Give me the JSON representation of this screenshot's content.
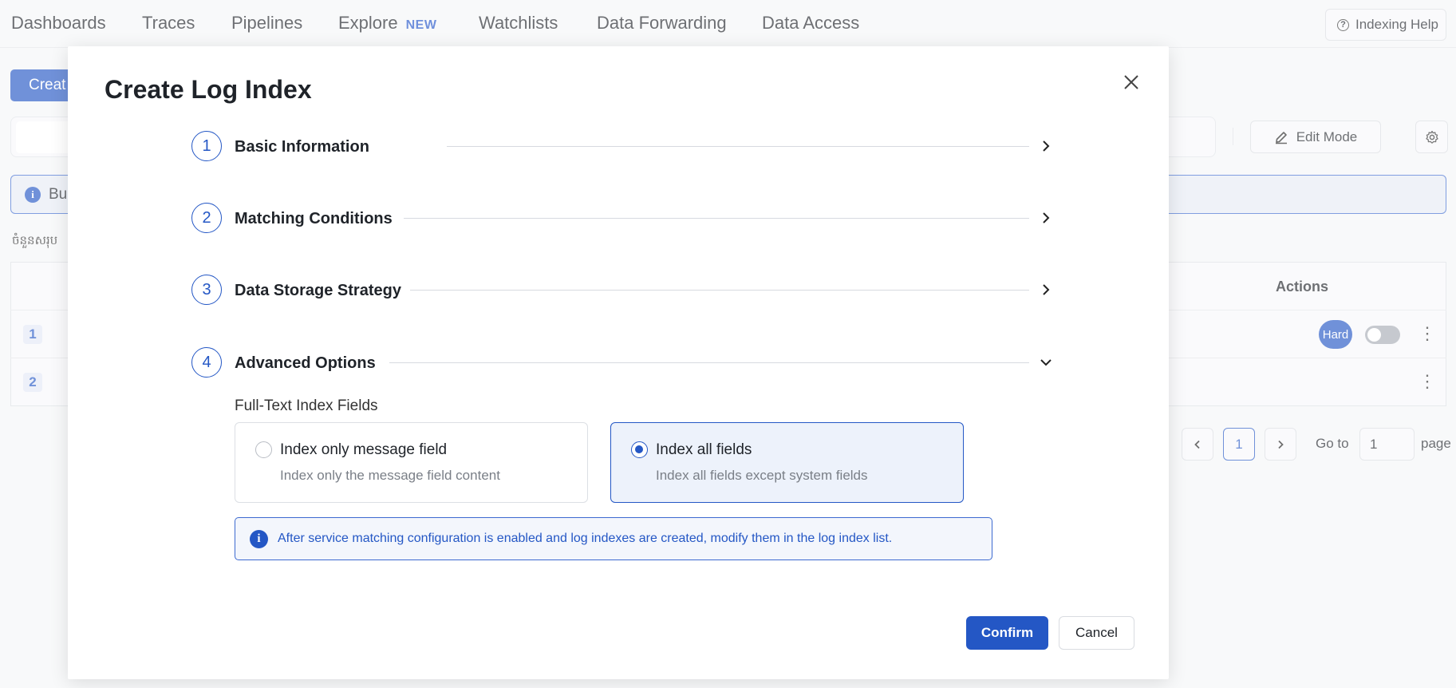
{
  "nav": {
    "items": [
      "Dashboards",
      "Traces",
      "Pipelines",
      "Explore",
      "Watchlists",
      "Data Forwarding",
      "Data Access"
    ],
    "explore_badge": "NEW",
    "help_button": "Indexing Help"
  },
  "background": {
    "create_button": "Creat",
    "banner_text": "Bu",
    "caption": "ចំនួនសរុប",
    "actions_header": "Actions",
    "rows": [
      "1",
      "2"
    ],
    "hard_badge": "Hard",
    "edit_mode": "Edit Mode",
    "pagination": {
      "current_page": "1",
      "goto_label": "Go to",
      "goto_value": "1",
      "page_label": "page"
    }
  },
  "modal": {
    "title": "Create Log Index",
    "steps": [
      {
        "num": "1",
        "label": "Basic Information",
        "state": "collapsed"
      },
      {
        "num": "2",
        "label": "Matching Conditions",
        "state": "collapsed"
      },
      {
        "num": "3",
        "label": "Data Storage Strategy",
        "state": "collapsed"
      },
      {
        "num": "4",
        "label": "Advanced Options",
        "state": "expanded"
      }
    ],
    "fields_label": "Full-Text Index Fields",
    "options": [
      {
        "title": "Index only message field",
        "desc": "Index only the message field content",
        "selected": false
      },
      {
        "title": "Index all fields",
        "desc": "Index all fields except system fields",
        "selected": true
      }
    ],
    "info": "After service matching configuration is enabled and log indexes are created, modify them in the log index list.",
    "confirm": "Confirm",
    "cancel": "Cancel"
  },
  "colors": {
    "accent": "#2457c5",
    "background": "#f5f6f8"
  }
}
